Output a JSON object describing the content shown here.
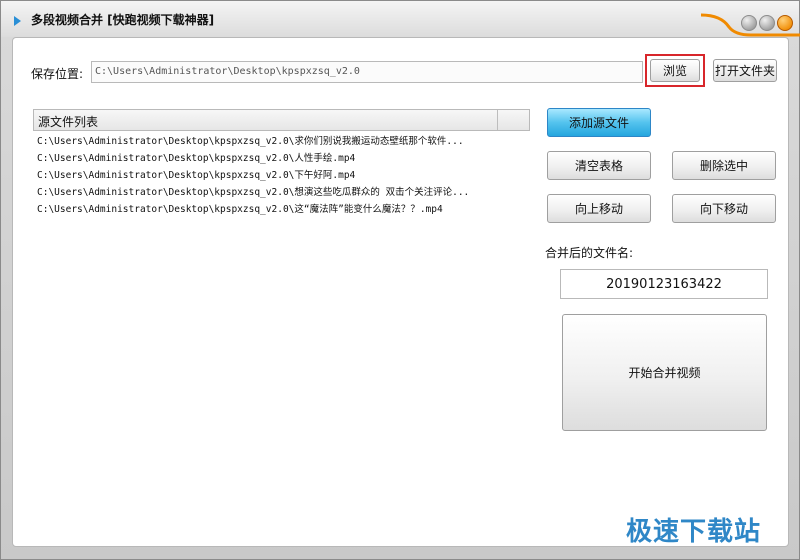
{
  "window": {
    "title": "多段视频合并 [快跑视频下载神器]"
  },
  "save": {
    "label": "保存位置:",
    "path": "C:\\Users\\Administrator\\Desktop\\kpspxzsq_v2.0",
    "browse_label": "浏览",
    "open_folder_label": "打开文件夹"
  },
  "source_list": {
    "header": "源文件列表",
    "items": [
      "C:\\Users\\Administrator\\Desktop\\kpspxzsq_v2.0\\求你们别说我搬运动态壁纸那个软件...",
      "C:\\Users\\Administrator\\Desktop\\kpspxzsq_v2.0\\人性手绘.mp4",
      "C:\\Users\\Administrator\\Desktop\\kpspxzsq_v2.0\\下午好阿.mp4",
      "C:\\Users\\Administrator\\Desktop\\kpspxzsq_v2.0\\想演这些吃瓜群众的 双击个关注评论...",
      "C:\\Users\\Administrator\\Desktop\\kpspxzsq_v2.0\\这“魔法阵”能变什么魔法？？.mp4"
    ]
  },
  "actions": {
    "add_source": "添加源文件",
    "clear_table": "清空表格",
    "delete_selected": "删除选中",
    "move_up": "向上移动",
    "move_down": "向下移动"
  },
  "output": {
    "filename_label": "合并后的文件名:",
    "filename_value": "20190123163422",
    "start_merge": "开始合并视频"
  },
  "watermark": "极速下载站",
  "colors": {
    "accent_blue": "#25a6de",
    "highlight_red": "#d8262b",
    "close_orange": "#f08a00"
  }
}
